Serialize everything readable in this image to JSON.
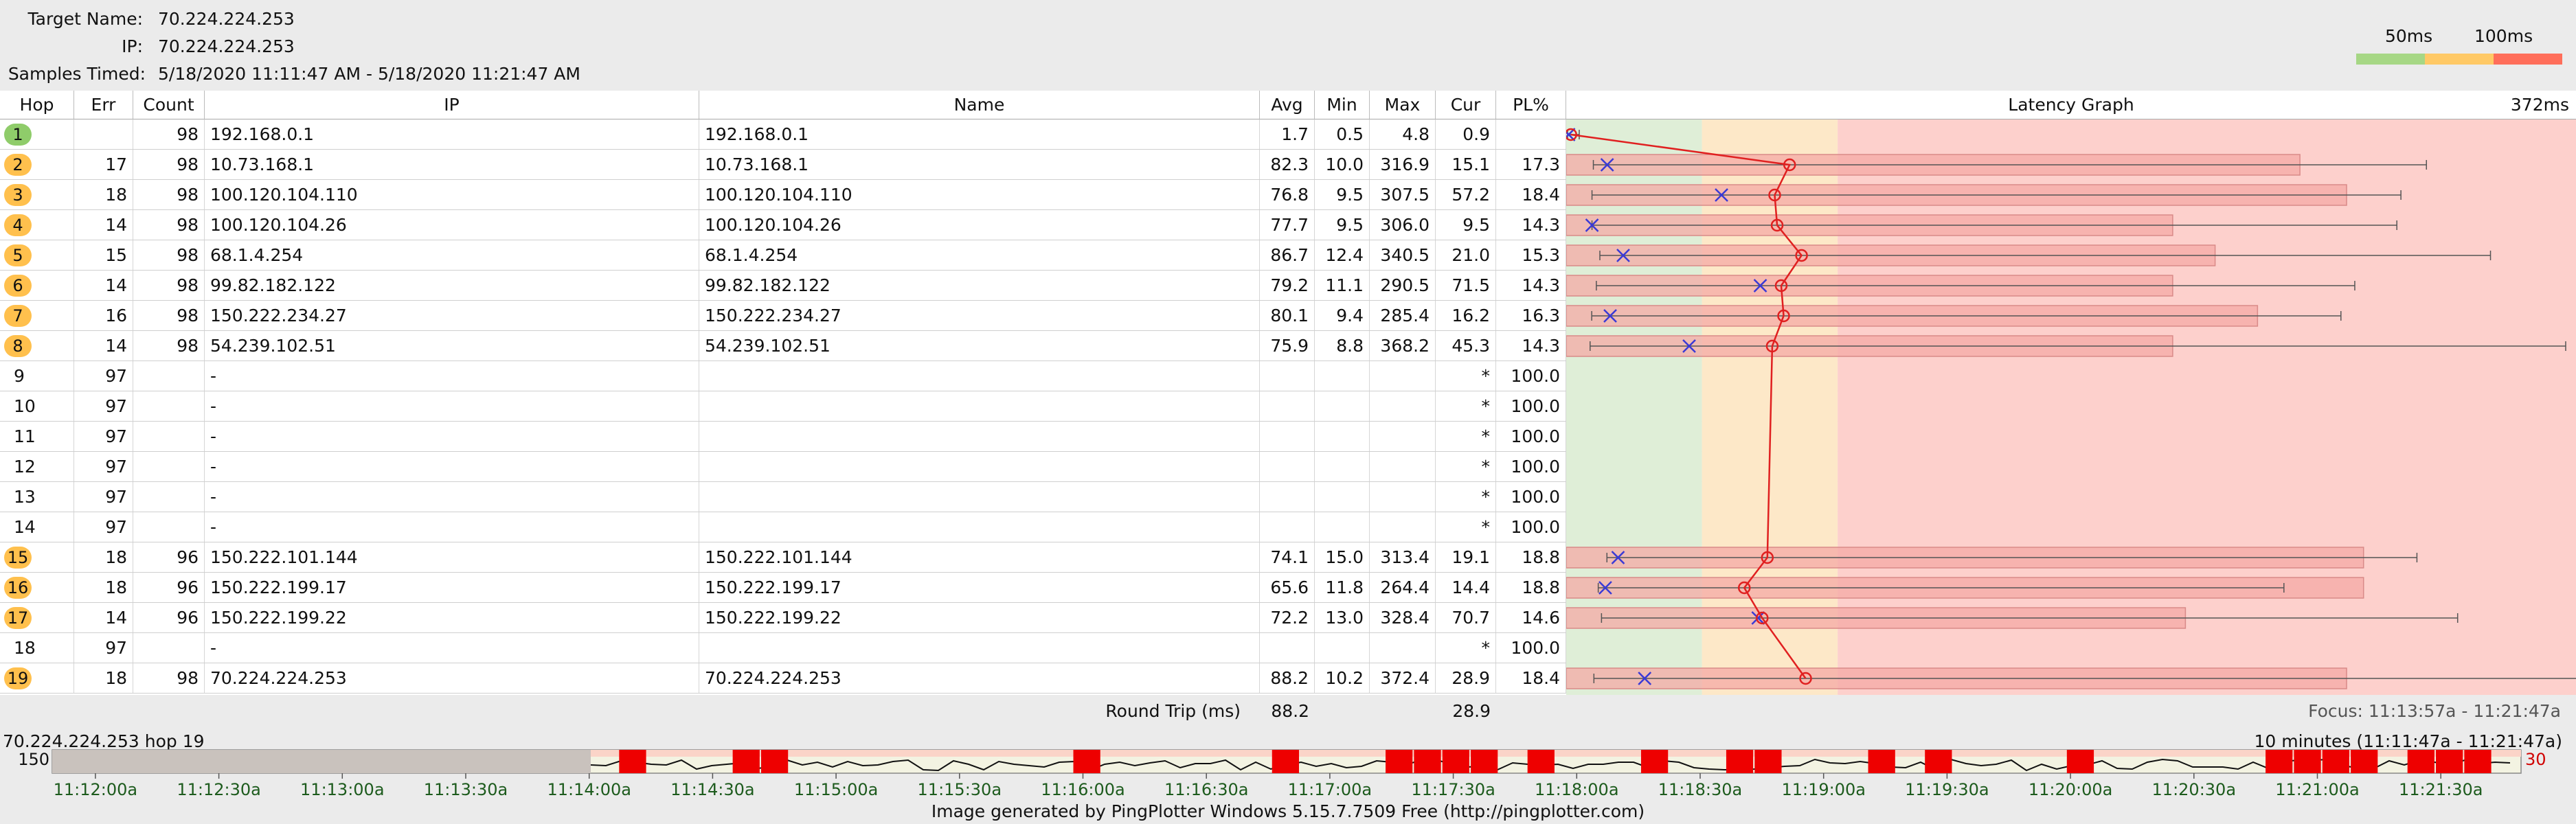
{
  "header": {
    "target_label": "Target Name:",
    "target_value": "70.224.224.253",
    "ip_label": "IP:",
    "ip_value": "70.224.224.253",
    "samples_label": "Samples Timed:",
    "samples_value": "5/18/2020 11:11:47 AM - 5/18/2020 11:21:47 AM"
  },
  "legend": {
    "label_50": "50ms",
    "label_100": "100ms",
    "colors": {
      "good": "#a6d785",
      "warn": "#ffc966",
      "bad": "#ff6e5a"
    }
  },
  "columns": {
    "hop": "Hop",
    "err": "Err",
    "count": "Count",
    "ip": "IP",
    "name": "Name",
    "avg": "Avg",
    "min": "Min",
    "max": "Max",
    "cur": "Cur",
    "pl": "PL%",
    "graph": "Latency Graph",
    "graph_max": "372ms"
  },
  "graph_scale": {
    "max_ms": 372,
    "green_until_ms": 50,
    "yellow_until_ms": 100
  },
  "hop_colors": {
    "green": "#8fcc6a",
    "orange": "#ffc04d"
  },
  "hops": [
    {
      "hop": "1",
      "err": "",
      "count": "98",
      "ip": "192.168.0.1",
      "name": "192.168.0.1",
      "avg": "1.7",
      "min": "0.5",
      "max": "4.8",
      "cur": "0.9",
      "pl": "",
      "badge": "green"
    },
    {
      "hop": "2",
      "err": "17",
      "count": "98",
      "ip": "10.73.168.1",
      "name": "10.73.168.1",
      "avg": "82.3",
      "min": "10.0",
      "max": "316.9",
      "cur": "15.1",
      "pl": "17.3",
      "badge": "orange"
    },
    {
      "hop": "3",
      "err": "18",
      "count": "98",
      "ip": "100.120.104.110",
      "name": "100.120.104.110",
      "avg": "76.8",
      "min": "9.5",
      "max": "307.5",
      "cur": "57.2",
      "pl": "18.4",
      "badge": "orange"
    },
    {
      "hop": "4",
      "err": "14",
      "count": "98",
      "ip": "100.120.104.26",
      "name": "100.120.104.26",
      "avg": "77.7",
      "min": "9.5",
      "max": "306.0",
      "cur": "9.5",
      "pl": "14.3",
      "badge": "orange"
    },
    {
      "hop": "5",
      "err": "15",
      "count": "98",
      "ip": "68.1.4.254",
      "name": "68.1.4.254",
      "avg": "86.7",
      "min": "12.4",
      "max": "340.5",
      "cur": "21.0",
      "pl": "15.3",
      "badge": "orange"
    },
    {
      "hop": "6",
      "err": "14",
      "count": "98",
      "ip": "99.82.182.122",
      "name": "99.82.182.122",
      "avg": "79.2",
      "min": "11.1",
      "max": "290.5",
      "cur": "71.5",
      "pl": "14.3",
      "badge": "orange"
    },
    {
      "hop": "7",
      "err": "16",
      "count": "98",
      "ip": "150.222.234.27",
      "name": "150.222.234.27",
      "avg": "80.1",
      "min": "9.4",
      "max": "285.4",
      "cur": "16.2",
      "pl": "16.3",
      "badge": "orange"
    },
    {
      "hop": "8",
      "err": "14",
      "count": "98",
      "ip": "54.239.102.51",
      "name": "54.239.102.51",
      "avg": "75.9",
      "min": "8.8",
      "max": "368.2",
      "cur": "45.3",
      "pl": "14.3",
      "badge": "orange"
    },
    {
      "hop": "9",
      "err": "97",
      "count": "",
      "ip": "-",
      "name": "",
      "avg": "",
      "min": "",
      "max": "",
      "cur": "*",
      "pl": "100.0",
      "badge": ""
    },
    {
      "hop": "10",
      "err": "97",
      "count": "",
      "ip": "-",
      "name": "",
      "avg": "",
      "min": "",
      "max": "",
      "cur": "*",
      "pl": "100.0",
      "badge": ""
    },
    {
      "hop": "11",
      "err": "97",
      "count": "",
      "ip": "-",
      "name": "",
      "avg": "",
      "min": "",
      "max": "",
      "cur": "*",
      "pl": "100.0",
      "badge": ""
    },
    {
      "hop": "12",
      "err": "97",
      "count": "",
      "ip": "-",
      "name": "",
      "avg": "",
      "min": "",
      "max": "",
      "cur": "*",
      "pl": "100.0",
      "badge": ""
    },
    {
      "hop": "13",
      "err": "97",
      "count": "",
      "ip": "-",
      "name": "",
      "avg": "",
      "min": "",
      "max": "",
      "cur": "*",
      "pl": "100.0",
      "badge": ""
    },
    {
      "hop": "14",
      "err": "97",
      "count": "",
      "ip": "-",
      "name": "",
      "avg": "",
      "min": "",
      "max": "",
      "cur": "*",
      "pl": "100.0",
      "badge": ""
    },
    {
      "hop": "15",
      "err": "18",
      "count": "96",
      "ip": "150.222.101.144",
      "name": "150.222.101.144",
      "avg": "74.1",
      "min": "15.0",
      "max": "313.4",
      "cur": "19.1",
      "pl": "18.8",
      "badge": "orange"
    },
    {
      "hop": "16",
      "err": "18",
      "count": "96",
      "ip": "150.222.199.17",
      "name": "150.222.199.17",
      "avg": "65.6",
      "min": "11.8",
      "max": "264.4",
      "cur": "14.4",
      "pl": "18.8",
      "badge": "orange"
    },
    {
      "hop": "17",
      "err": "14",
      "count": "96",
      "ip": "150.222.199.22",
      "name": "150.222.199.22",
      "avg": "72.2",
      "min": "13.0",
      "max": "328.4",
      "cur": "70.7",
      "pl": "14.6",
      "badge": "orange"
    },
    {
      "hop": "18",
      "err": "97",
      "count": "",
      "ip": "-",
      "name": "",
      "avg": "",
      "min": "",
      "max": "",
      "cur": "*",
      "pl": "100.0",
      "badge": ""
    },
    {
      "hop": "19",
      "err": "18",
      "count": "98",
      "ip": "70.224.224.253",
      "name": "70.224.224.253",
      "avg": "88.2",
      "min": "10.2",
      "max": "372.4",
      "cur": "28.9",
      "pl": "18.4",
      "badge": "orange"
    }
  ],
  "round_trip": {
    "label": "Round Trip (ms)",
    "avg": "88.2",
    "cur": "28.9",
    "focus": "Focus: 11:13:57a - 11:21:47a"
  },
  "timeline": {
    "hop_label": "70.224.224.253 hop 19",
    "range_label": "10 minutes (11:11:47a - 11:21:47a)",
    "y_max_label": "150",
    "right_label": "30",
    "ticks": [
      "11:12:00a",
      "11:12:30a",
      "11:13:00a",
      "11:13:30a",
      "11:14:00a",
      "11:14:30a",
      "11:15:00a",
      "11:15:30a",
      "11:16:00a",
      "11:16:30a",
      "11:17:00a",
      "11:17:30a",
      "11:18:00a",
      "11:18:30a",
      "11:19:00a",
      "11:19:30a",
      "11:20:00a",
      "11:20:30a",
      "11:21:00a",
      "11:21:30a"
    ],
    "loss_marks": [
      1,
      5,
      6,
      17,
      24,
      28,
      29,
      30,
      31,
      33,
      37,
      40,
      41,
      45,
      47,
      52,
      59,
      60,
      61,
      62,
      64,
      65,
      66
    ]
  },
  "footer": "Image generated by PingPlotter Windows 5.15.7.7509 Free (http://pingplotter.com)"
}
